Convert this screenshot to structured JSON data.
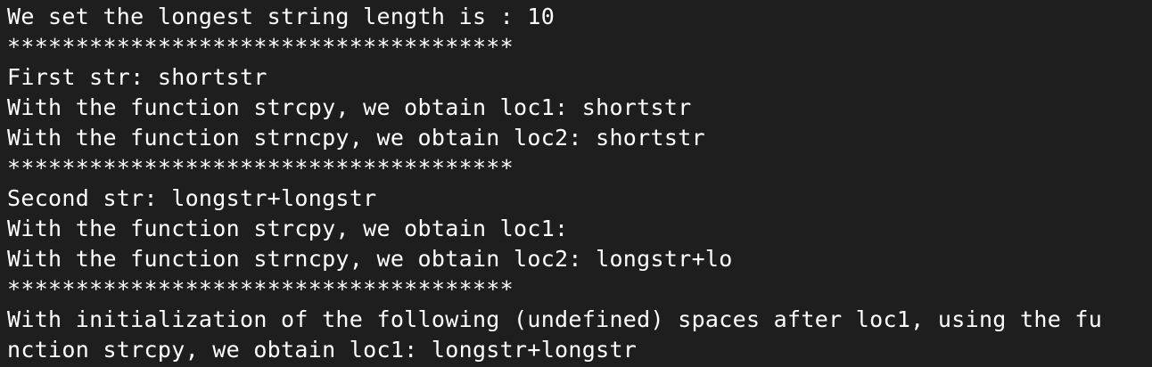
{
  "terminal": {
    "lines": [
      "We set the longest string length is : 10",
      "*************************************",
      "First str: shortstr",
      "With the function strcpy, we obtain loc1: shortstr",
      "With the function strncpy, we obtain loc2: shortstr",
      "*************************************",
      "Second str: longstr+longstr",
      "With the function strcpy, we obtain loc1:",
      "With the function strncpy, we obtain loc2: longstr+lo",
      "*************************************",
      "With initialization of the following (undefined) spaces after loc1, using the fu",
      "nction strcpy, we obtain loc1: longstr+longstr"
    ]
  }
}
